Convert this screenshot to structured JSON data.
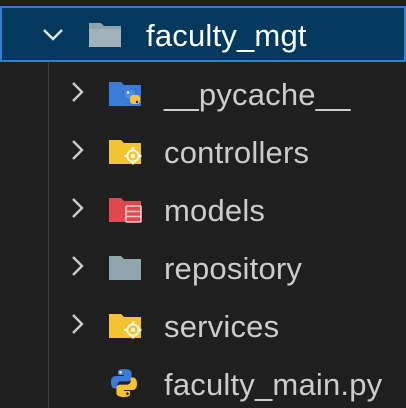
{
  "explorer": {
    "root": {
      "label": "faculty_mgt",
      "expanded": true,
      "icon": "folder-icon",
      "icon_color": "#90a4ae"
    },
    "items": [
      {
        "label": "__pycache__",
        "type": "folder",
        "expanded": false,
        "icon": "python-folder-icon",
        "icon_color": "#3b7bd8"
      },
      {
        "label": "controllers",
        "type": "folder",
        "expanded": false,
        "icon": "gear-folder-icon",
        "icon_color": "#f4c430"
      },
      {
        "label": "models",
        "type": "folder",
        "expanded": false,
        "icon": "database-folder-icon",
        "icon_color": "#e0484d"
      },
      {
        "label": "repository",
        "type": "folder",
        "expanded": false,
        "icon": "folder-icon",
        "icon_color": "#90a4ae"
      },
      {
        "label": "services",
        "type": "folder",
        "expanded": false,
        "icon": "gear-folder-icon",
        "icon_color": "#f4c430"
      },
      {
        "label": "faculty_main.py",
        "type": "file",
        "icon": "python-file-icon",
        "icon_color": "#3b7bd8"
      }
    ]
  }
}
